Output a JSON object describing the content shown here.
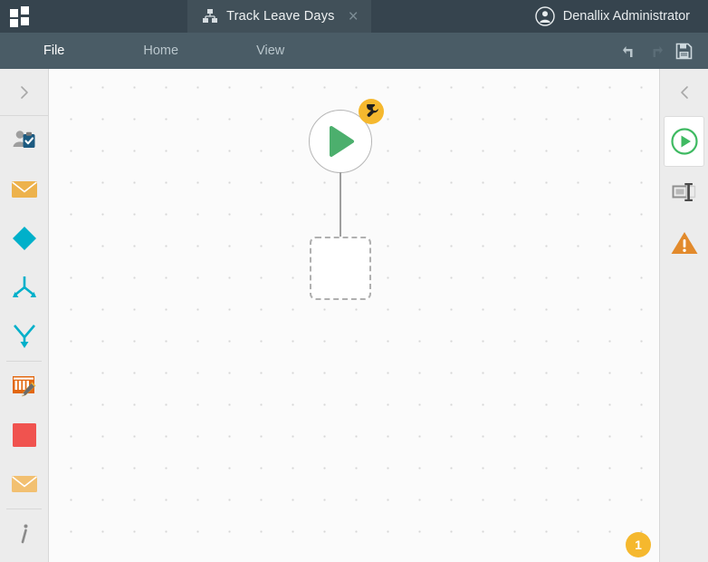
{
  "titlebar": {
    "logo_name": "app-logo",
    "tab": {
      "icon": "workflow-icon",
      "title": "Track Leave Days",
      "close_label": "×"
    },
    "user": {
      "icon": "user-avatar-icon",
      "name": "Denallix Administrator"
    }
  },
  "menubar": {
    "items": [
      {
        "label": "File",
        "active": true
      },
      {
        "label": "Home",
        "active": false
      },
      {
        "label": "View",
        "active": false
      }
    ],
    "tools": [
      {
        "name": "undo-icon",
        "label": "Undo",
        "enabled": true
      },
      {
        "name": "redo-icon",
        "label": "Redo",
        "enabled": false
      },
      {
        "name": "save-icon",
        "label": "Save",
        "enabled": true
      }
    ]
  },
  "sidebar_left": {
    "collapse_label": "›",
    "collapse_name": "expand-left-panel-chevron-icon",
    "items": [
      {
        "name": "user-task-icon",
        "label": "User Task"
      },
      {
        "name": "mail-event-icon",
        "label": "Mail Event"
      },
      {
        "name": "decision-diamond-icon",
        "label": "Decision"
      },
      {
        "name": "merge-arrows-icon",
        "label": "Merge"
      },
      {
        "name": "converge-arrow-icon",
        "label": "Converge"
      },
      {
        "name": "form-edit-icon",
        "label": "Form"
      },
      {
        "name": "stop-square-icon",
        "label": "Stop"
      },
      {
        "name": "envelope-icon",
        "label": "Email"
      },
      {
        "name": "info-icon",
        "label": "Information"
      }
    ]
  },
  "sidebar_right": {
    "collapse_label": "‹",
    "collapse_name": "collapse-right-panel-chevron-icon",
    "items": [
      {
        "name": "start-node-icon",
        "label": "Start",
        "selected": true
      },
      {
        "name": "rename-icon",
        "label": "Rename",
        "selected": false
      },
      {
        "name": "warning-icon",
        "label": "Validation Warnings",
        "selected": false
      }
    ]
  },
  "canvas": {
    "start_node": {
      "name": "start-node",
      "icon": "play-icon",
      "badge": {
        "name": "wrench-badge-icon",
        "label": "Configure"
      }
    },
    "placeholder_node": {
      "name": "placeholder-node",
      "label": ""
    },
    "connector": {
      "name": "connector-arrow"
    },
    "issue_badge": {
      "name": "issue-count-badge",
      "count": "1"
    }
  },
  "colors": {
    "titlebar_bg": "#36444e",
    "tab_bg": "#415059",
    "menubar_bg": "#4a5c66",
    "sidebar_bg": "#ececec",
    "canvas_bg": "#fbfbfb",
    "accent_green": "#4caf6d",
    "accent_orange": "#f5b82e",
    "accent_cyan": "#00b0ca",
    "accent_red": "#f0534f",
    "accent_dark_orange": "#e2670f"
  }
}
